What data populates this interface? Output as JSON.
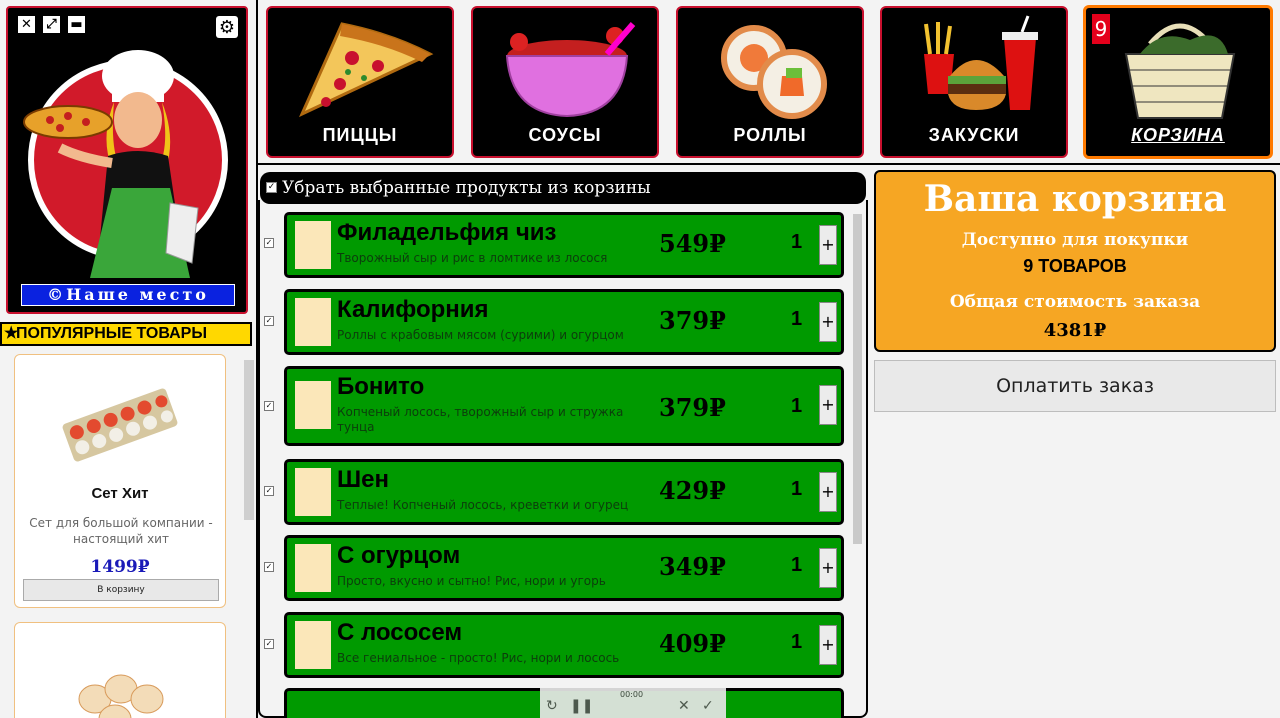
{
  "window": {
    "close_glyph": "✕",
    "fullscreen_glyph": "⤢",
    "minimize_glyph": "▬",
    "settings_glyph": "⚙"
  },
  "brand": {
    "name": "©Наше место"
  },
  "popular": {
    "title": "ПОПУЛЯРНЫЕ ТОВАРЫ",
    "star": "★",
    "items": [
      {
        "name": "Сет Хит",
        "description": "Сет для большой компании - настоящий хит",
        "price": "1499₽",
        "button": "В корзину"
      }
    ]
  },
  "categories": [
    {
      "label": "ПИЦЦЫ",
      "icon": "pizza-icon"
    },
    {
      "label": "СОУСЫ",
      "icon": "sauce-bowl-icon"
    },
    {
      "label": "РОЛЛЫ",
      "icon": "roll-icon"
    },
    {
      "label": "ЗАКУСКИ",
      "icon": "burger-icon"
    },
    {
      "label": "КОРЗИНА",
      "icon": "basket-icon",
      "badge": "9",
      "active": true
    }
  ],
  "cart": {
    "header": "Убрать выбранные продукты из корзины",
    "check_glyph": "✓",
    "plus_glyph": "+",
    "items": [
      {
        "name": "Филадельфия чиз",
        "description": "Творожный сыр и рис в ломтике из лосося",
        "price": "549₽",
        "qty": "1"
      },
      {
        "name": "Калифорния",
        "description": "Роллы с крабовым мясом (сурими) и огурцом",
        "price": "379₽",
        "qty": "1"
      },
      {
        "name": "Бонито",
        "description": "Копченый лосось, творожный сыр и стружка тунца",
        "price": "379₽",
        "qty": "1"
      },
      {
        "name": "Шен",
        "description": "Теплые! Копченый лосось, креветки и огурец",
        "price": "429₽",
        "qty": "1"
      },
      {
        "name": "С огурцом",
        "description": "Просто, вкусно и сытно! Рис, нори и угорь",
        "price": "349₽",
        "qty": "1"
      },
      {
        "name": "С лососем",
        "description": "Все гениальное - просто! Рис, нори и лосось",
        "price": "409₽",
        "qty": "1"
      }
    ]
  },
  "media": {
    "time": "00:00"
  },
  "summary": {
    "title": "Ваша корзина",
    "available_label": "Доступно для покупки",
    "count": "9 ТОВАРОВ",
    "total_label": "Общая стоимость заказа",
    "total": "4381₽",
    "pay_button": "Оплатить заказ"
  },
  "colors": {
    "accent_red": "#c8102e",
    "item_green": "#009a00",
    "summary_orange": "#f6a623",
    "brand_blue": "#0a22e0",
    "popular_yellow": "#ffd800"
  }
}
